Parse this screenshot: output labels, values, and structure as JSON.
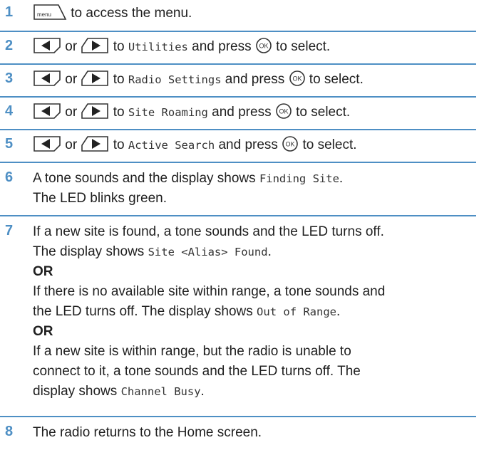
{
  "icons": {
    "menu_key": "menu-key-icon",
    "left_key": "left-arrow-key-icon",
    "right_key": "right-arrow-key-icon",
    "ok_key": "ok-key-icon",
    "menu_key_text": "menu",
    "ok_key_text": "OK"
  },
  "colors": {
    "accent": "#4e8fc4",
    "text": "#1f1f1f"
  },
  "steps": [
    {
      "num": "1",
      "t1": " to access the menu."
    },
    {
      "num": "2",
      "or": "or",
      "to": " to ",
      "target": "Utilities",
      "press": " and press ",
      "select": " to select."
    },
    {
      "num": "3",
      "or": "or",
      "to": " to ",
      "target": "Radio Settings",
      "press": " and press ",
      "select": " to select."
    },
    {
      "num": "4",
      "or": "or",
      "to": " to ",
      "target": "Site Roaming",
      "press": " and press ",
      "select": " to select."
    },
    {
      "num": "5",
      "or": "or",
      "to": " to ",
      "target": "Active Search",
      "press": " and press ",
      "select": " to select."
    },
    {
      "num": "6",
      "l1a": "A tone sounds and the display shows ",
      "l1b": "Finding Site",
      "l1c": ".",
      "l2": "The LED blinks green."
    },
    {
      "num": "7",
      "a1": "If a new site is found, a tone sounds and the LED turns off.",
      "a2a": "The display shows ",
      "a2b": "Site <Alias> Found",
      "a2c": ".",
      "or1": "OR",
      "b1": "If there is no available site within range, a tone sounds and",
      "b2a": "the LED turns off. The display shows ",
      "b2b": "Out of Range",
      "b2c": ".",
      "or2": "OR",
      "c1": "If a new site is within range, but the radio is unable to",
      "c2": "connect to it, a tone sounds and the LED turns off. The",
      "c3a": "display shows ",
      "c3b": "Channel Busy",
      "c3c": "."
    },
    {
      "num": "8",
      "t1": "The radio returns to the Home screen."
    }
  ]
}
